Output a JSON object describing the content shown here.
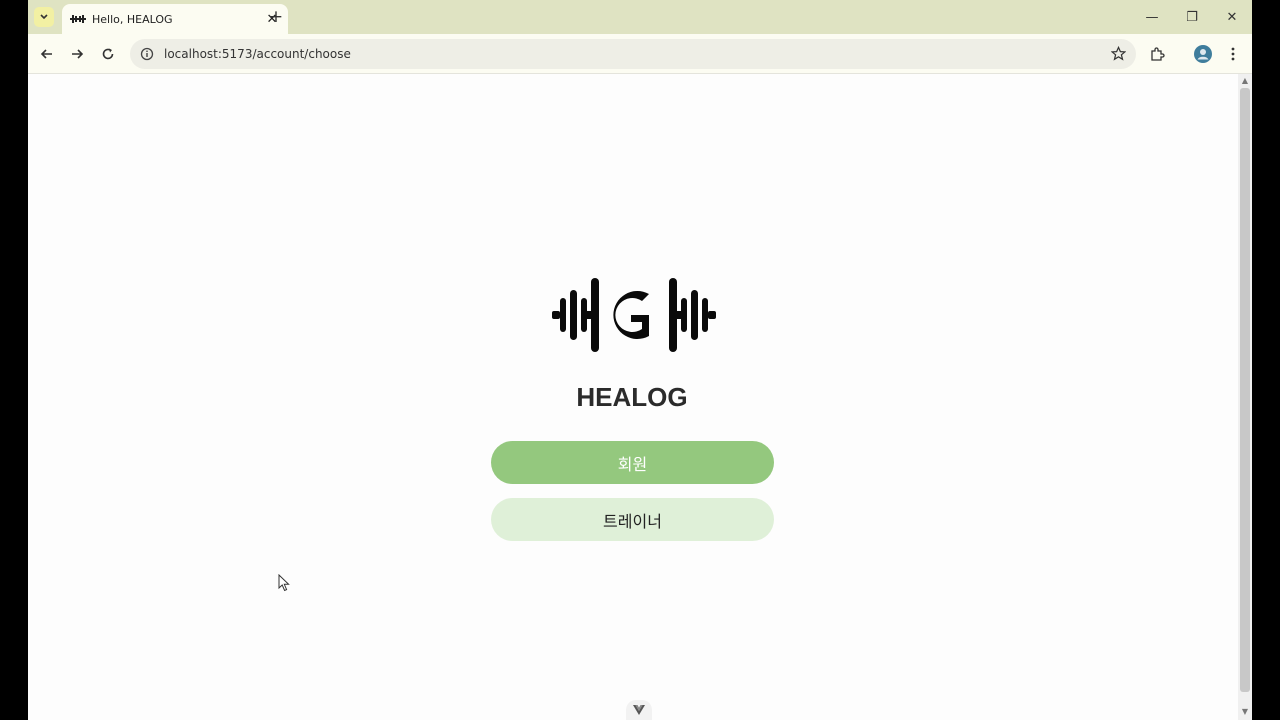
{
  "browser": {
    "tab": {
      "title": "Hello, HEALOG",
      "close": "✕"
    },
    "new_tab": "+",
    "window_controls": {
      "minimize": "—",
      "restore": "❐",
      "close": "✕"
    },
    "address_bar": {
      "url": "localhost:5173/account/choose"
    },
    "icons": [
      "tab-search-icon",
      "back-icon",
      "forward-icon",
      "reload-icon",
      "info-icon",
      "star-icon",
      "extensions-icon",
      "profile-icon",
      "menu-icon"
    ]
  },
  "page": {
    "logo_icon": "barbell-g-logo",
    "brand": "HEALOG",
    "buttons": {
      "member": "회원",
      "trainer": "트레이너"
    }
  },
  "colors": {
    "member_button": "#94c87e",
    "trainer_button": "#dff0d8",
    "tabstrip": "#dfe3c2"
  }
}
